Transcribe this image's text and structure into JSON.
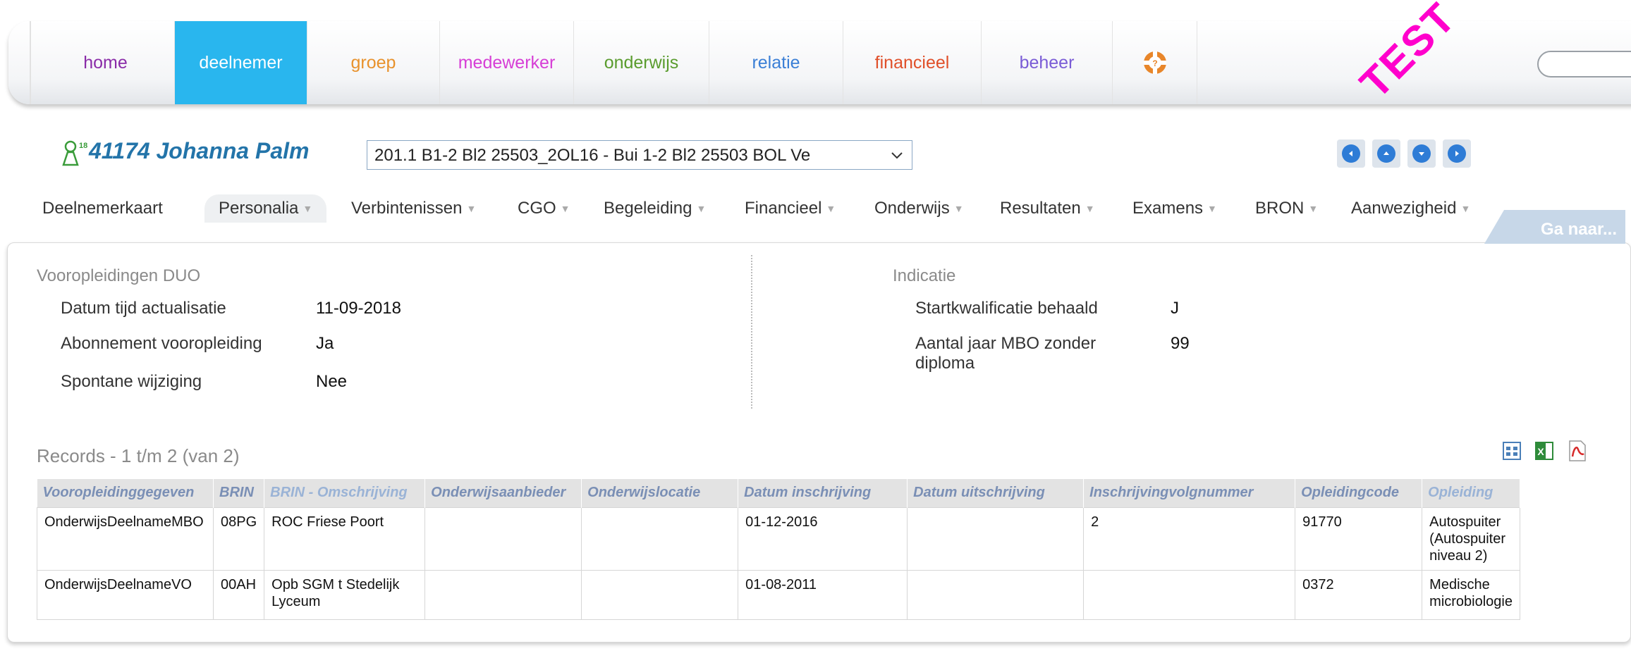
{
  "nav": {
    "tabs": [
      {
        "label": "home",
        "color": "#8a2ca8"
      },
      {
        "label": "deelnemer",
        "color": "#ffffff",
        "active": true
      },
      {
        "label": "groep",
        "color": "#e8922c"
      },
      {
        "label": "medewerker",
        "color": "#d63ed6"
      },
      {
        "label": "onderwijs",
        "color": "#5a9c2e"
      },
      {
        "label": "relatie",
        "color": "#3a7fd6"
      },
      {
        "label": "financieel",
        "color": "#e0502a"
      },
      {
        "label": "beheer",
        "color": "#7a5cd6"
      }
    ],
    "help_icon": "lifebuoy-icon",
    "test_stamp": "TEST"
  },
  "student": {
    "icon": "student-icon",
    "name": "41174 Johanna Palm",
    "enrollment": "201.1 B1-2 Bl2 25503_2OL16 - Bui 1-2 Bl2 25503 BOL Ve"
  },
  "pager": [
    "first-icon",
    "previous-icon",
    "next-icon",
    "last-icon"
  ],
  "submenu": [
    {
      "label": "Deelnemerkaart",
      "dropdown": false
    },
    {
      "label": "Personalia",
      "dropdown": true,
      "active": true
    },
    {
      "label": "Verbintenissen",
      "dropdown": true
    },
    {
      "label": "CGO",
      "dropdown": true
    },
    {
      "label": "Begeleiding",
      "dropdown": true
    },
    {
      "label": "Financieel",
      "dropdown": true
    },
    {
      "label": "Onderwijs",
      "dropdown": true
    },
    {
      "label": "Resultaten",
      "dropdown": true
    },
    {
      "label": "Examens",
      "dropdown": true
    },
    {
      "label": "BRON",
      "dropdown": true
    },
    {
      "label": "Aanwezigheid",
      "dropdown": true
    }
  ],
  "goto_label": "Ga naar...",
  "vooropleidingen": {
    "title": "Vooropleidingen DUO",
    "fields": [
      {
        "label": "Datum tijd actualisatie",
        "value": "11-09-2018"
      },
      {
        "label": "Abonnement vooropleiding",
        "value": "Ja"
      },
      {
        "label": "Spontane wijziging",
        "value": "Nee"
      }
    ]
  },
  "indicatie": {
    "title": "Indicatie",
    "fields": [
      {
        "label": "Startkwalificatie behaald",
        "value": "J"
      },
      {
        "label": "Aantal jaar MBO zonder diploma",
        "value": "99"
      }
    ]
  },
  "records": {
    "title": "Records - 1 t/m 2 (van 2)",
    "export_icons": [
      "print-icon",
      "excel-icon",
      "pdf-icon"
    ],
    "columns": [
      "Vooropleidinggegeven",
      "BRIN",
      "BRIN - Omschrijving",
      "Onderwijsaanbieder",
      "Onderwijslocatie",
      "Datum inschrijving",
      "Datum uitschrijving",
      "Inschrijvingvolgnummer",
      "Opleidingcode",
      "Opleiding"
    ],
    "rows": [
      [
        "OnderwijsDeelnameMBO",
        "08PG",
        "ROC Friese Poort",
        "",
        "",
        "01-12-2016",
        "",
        "2",
        "91770",
        "Autospuiter (Autospuiter niveau 2)"
      ],
      [
        "OnderwijsDeelnameVO",
        "00AH",
        "Opb SGM t Stedelijk Lyceum",
        "",
        "",
        "01-08-2011",
        "",
        "",
        "0372",
        "Medische microbiologie"
      ]
    ]
  }
}
